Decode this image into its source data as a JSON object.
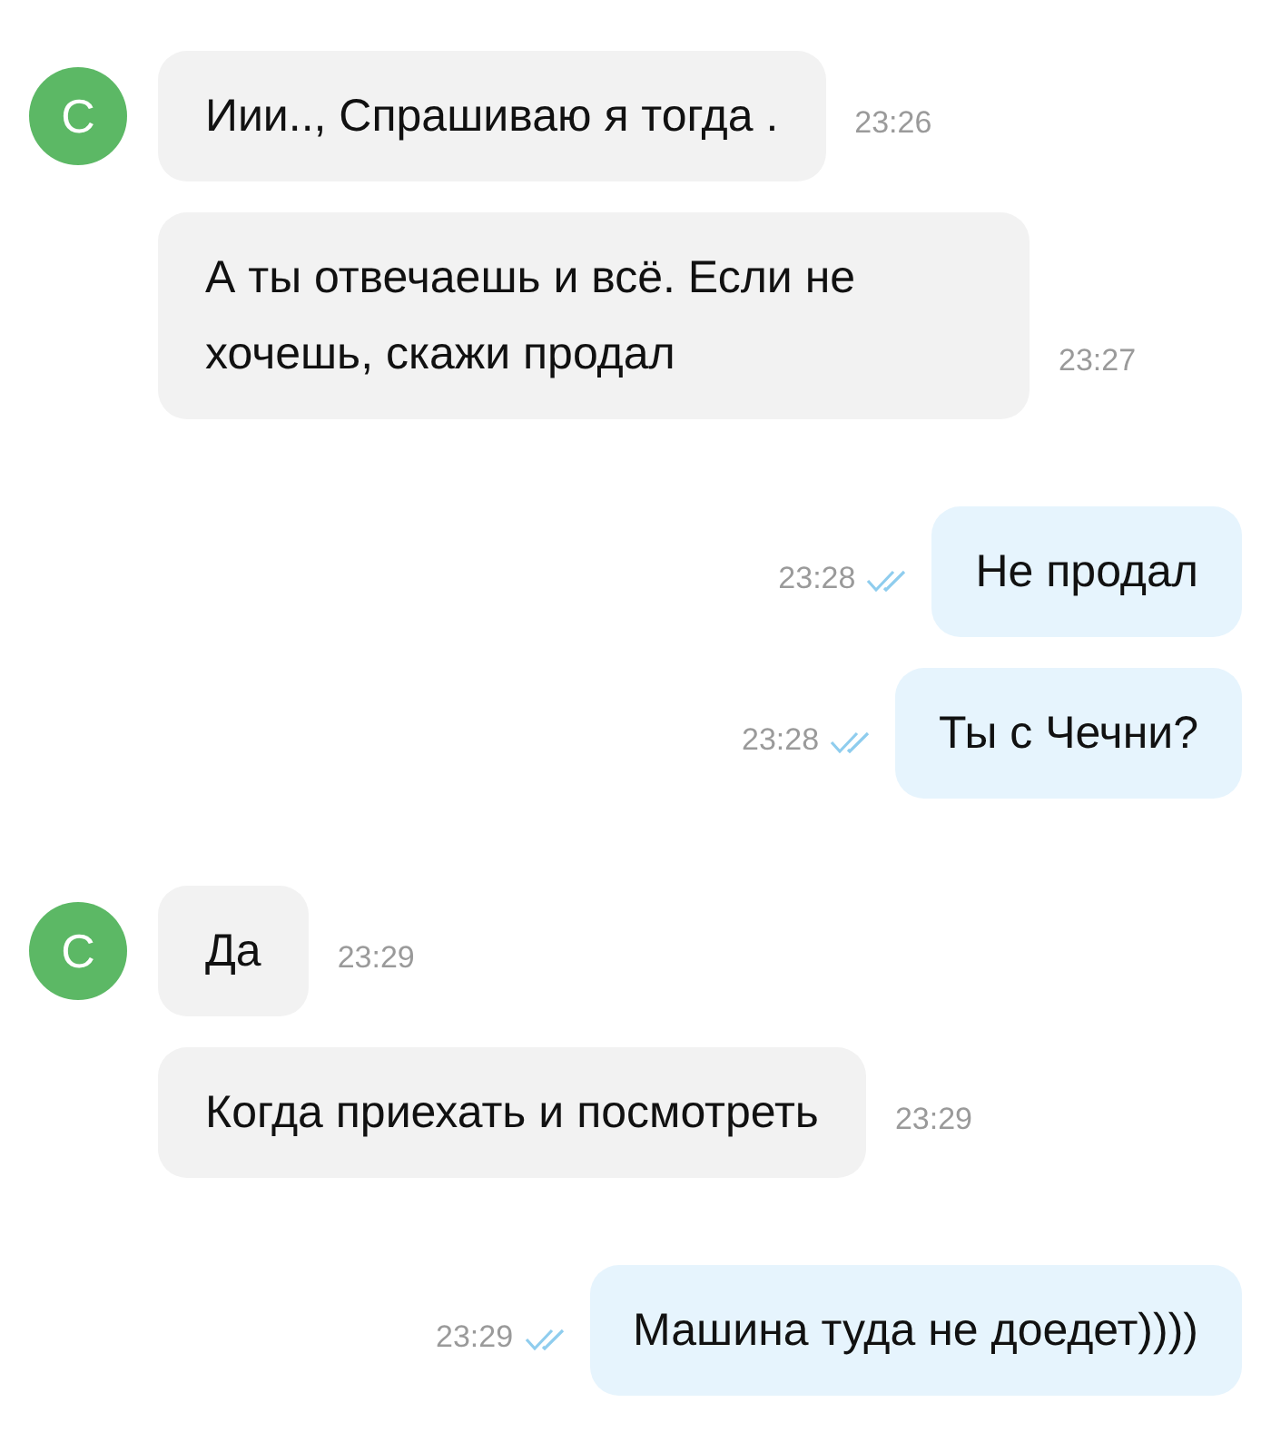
{
  "groups": [
    {
      "kind": "incoming",
      "avatar": "С",
      "messages": [
        {
          "text": "Иии.., Спрашиваю я тогда .",
          "time": "23:26"
        },
        {
          "text": "А ты отвечаешь и всё. Если не хочешь, скажи продал",
          "time": "23:27"
        }
      ]
    },
    {
      "kind": "outgoing",
      "messages": [
        {
          "text": "Не продал",
          "time": "23:28",
          "read": true
        },
        {
          "text": "Ты с Чечни?",
          "time": "23:28",
          "read": true
        }
      ]
    },
    {
      "kind": "incoming",
      "avatar": "С",
      "messages": [
        {
          "text": "Да",
          "time": "23:29"
        },
        {
          "text": "Когда приехать и посмотреть",
          "time": "23:29"
        }
      ]
    },
    {
      "kind": "outgoing",
      "messages": [
        {
          "text": "Машина туда не доедет))))",
          "time": "23:29",
          "read": true
        }
      ]
    }
  ]
}
